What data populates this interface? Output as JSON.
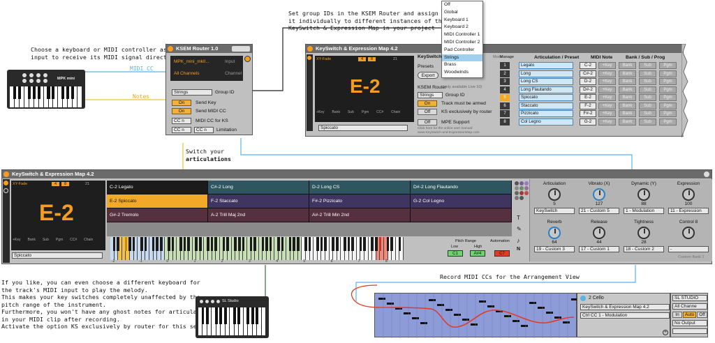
{
  "annotations": {
    "choose_keyboard": [
      "Choose a keyboard or MIDI controller as",
      "input to receive its MIDI signal directly"
    ],
    "set_group": [
      "Set group IDs in the KSEM Router and assign",
      "it individually to different instances of the",
      "KeySwitch & Expression Map in your project"
    ],
    "switch_articulations": [
      "Switch your",
      "articulations"
    ],
    "if_you_like": [
      "If you like, you can even choose a different keyboard for",
      "the track's MIDI input to play the melody.",
      "This makes your key switches completely unaffected by the",
      "pitch range of the instrument.",
      "Furthermore, you won't have any ghost notes for articulations",
      "in your MIDI clip after recording.",
      "Activate the option KS exclusively by router for this set-up"
    ],
    "record_ccs": "Record MIDI CCs for the Arrangement View",
    "midi_cc": "MIDI CC",
    "notes": "Notes"
  },
  "mpk": {
    "name": "MPK mini"
  },
  "sl": {
    "name": "SL Studio"
  },
  "router": {
    "title": "KSEM Router 1.0",
    "input_device": "MPK_mini_mkII...",
    "input_label": "Input",
    "channel_value": "All Channels",
    "channel_label": "Channel",
    "group_value": "Strings",
    "group_label": "Group ID",
    "send_key_state": "On",
    "send_key_label": "Send Key",
    "send_cc_state": "On",
    "send_cc_label": "Send MIDI CC",
    "cc_for_ks_a": "CC n",
    "cc_for_ks_b": "",
    "cc_for_ks_label": "MIDI CC for KS",
    "limit_a": "CC n",
    "limit_b": "CC n",
    "limit_label": "Limitation"
  },
  "group_menu": [
    "Off",
    "Global",
    "Keyboard 1",
    "Keyboard 2",
    "MIDI Controller 1",
    "MIDI Controller 2",
    "Pad Controller",
    "Strings",
    "Brass",
    "Woodwinds"
  ],
  "group_menu_selected": 7,
  "ksem_small": {
    "title": "KeySwitch & Expression Map 4.2",
    "fade": "XY-Fade",
    "slot_a": "4",
    "slot_b": "8",
    "num": "21",
    "big_note": "E-2",
    "bottom_labels": [
      "+Key",
      "Bank",
      "Sub",
      "Pgm",
      "CC#",
      "Chain"
    ],
    "preset_select": "Spiccato",
    "ks_label": "KeySwitch",
    "presets_label": "Presets",
    "export_btn": "Export",
    "router_label": "KSEM Router",
    "router_sub": "(only available Live 10)",
    "group_value": "Strings",
    "group_label": "Group ID",
    "armed_state": "On",
    "armed_label": "Track must be armed",
    "ks_excl_state": "Off",
    "ks_excl_label": "KS exclusively by router",
    "mpe_state": "Off",
    "mpe_label": "MPE Support",
    "manual_hint": "Click here for the online user manual: www.KeySwitch-and-ExpressionMap.com",
    "mode_label": "Mode",
    "manage_label": "Manage",
    "col_art": "Articulation / Preset",
    "col_note": "MIDI Note",
    "col_bank": "Bank / Sub / Prog",
    "rows": [
      {
        "n": "1",
        "art": "Legato",
        "note": "C-2"
      },
      {
        "n": "2",
        "art": "Long",
        "note": "C#-2"
      },
      {
        "n": "3",
        "art": "Long CS",
        "note": "D-2"
      },
      {
        "n": "4",
        "art": "Long Flautando",
        "note": "D#-2"
      },
      {
        "n": "5",
        "art": "Spiccato",
        "note": "E-2"
      },
      {
        "n": "6",
        "art": "Staccato",
        "note": "F-2"
      },
      {
        "n": "7",
        "art": "Pizzicato",
        "note": "F#-2"
      },
      {
        "n": "8",
        "art": "Col Legno",
        "note": "G-2"
      }
    ],
    "key_btn": "+Key",
    "bank_btn": "Bank",
    "sub_btn": "Sub",
    "pgm_btn": "Pgm"
  },
  "ksem_big": {
    "title": "KeySwitch & Expression Map 4.2",
    "fade": "XY-Fade",
    "slot_a": "4",
    "slot_b": "8",
    "num": "21",
    "big_note": "E-2",
    "bottom_labels": [
      "+Key",
      "Bank",
      "Sub",
      "Pgm",
      "CC#",
      "Chain"
    ],
    "preset_select": "Spiccato",
    "grid": [
      [
        "C-2 Legato",
        "C#-2 Long",
        "D-2 Long CS",
        "D#-2 Long Flautando"
      ],
      [
        "E-2 Spiccato",
        "F-2 Staccato",
        "F#-2 Pizzicato",
        "G-2 Col Legno"
      ],
      [
        "G#-2 Tremolo",
        "A-2 Trill Maj 2nd",
        "A#-2 Trill Min 2nd",
        ""
      ]
    ],
    "pitch_range_label": "Pitch Range",
    "low_label": "Low",
    "high_label": "High",
    "low_value": "C1",
    "high_value": "A#4",
    "automation_label": "Automation",
    "automation_value": "C7",
    "octave_labels": [
      "-2",
      "-1",
      "0",
      "1",
      "2",
      "3",
      "4",
      "5",
      "6",
      "7",
      "8"
    ],
    "knobs": [
      {
        "name": "Articulation",
        "value": "5",
        "select": "KeySwitch"
      },
      {
        "name": "Vibrato (X)",
        "value": "127",
        "select": "21 - Custom 5"
      },
      {
        "name": "Dynamic (Y)",
        "value": "88",
        "select": "1 - Modulation"
      },
      {
        "name": "Expression",
        "value": "100",
        "select": "11 - Expression"
      },
      {
        "name": "Reverb",
        "value": "64",
        "select": "19 - Custom 3"
      },
      {
        "name": "Release",
        "value": "44",
        "select": "17 - Custom 1"
      },
      {
        "name": "Tightness",
        "value": "28",
        "select": "18 - Custom 2"
      },
      {
        "name": "Control 8",
        "value": "",
        "select": "-"
      }
    ],
    "custom_bank": "Custom Bank 1"
  },
  "arrangement": {
    "track_name": "2 Cello",
    "device_select": "KeySwitch & Expression Map 4.2",
    "ctrl_select": "Ctrl CC  1 - Modulation",
    "input_device": "SL STUDIO",
    "input_channel": "All Channe",
    "in_btn": "In",
    "auto_btn": "Auto",
    "off_btn": "Off",
    "output": "No Output"
  },
  "colors": {
    "orange": "#f3a928",
    "title_gray": "#6b6b6b",
    "blue_line": "#58b4e6",
    "yellow_line": "#f0c030",
    "red_line": "#e23b25",
    "teal_cell": "#2e5560",
    "purple_cell": "#3f3560",
    "maroon_cell": "#55303e"
  }
}
